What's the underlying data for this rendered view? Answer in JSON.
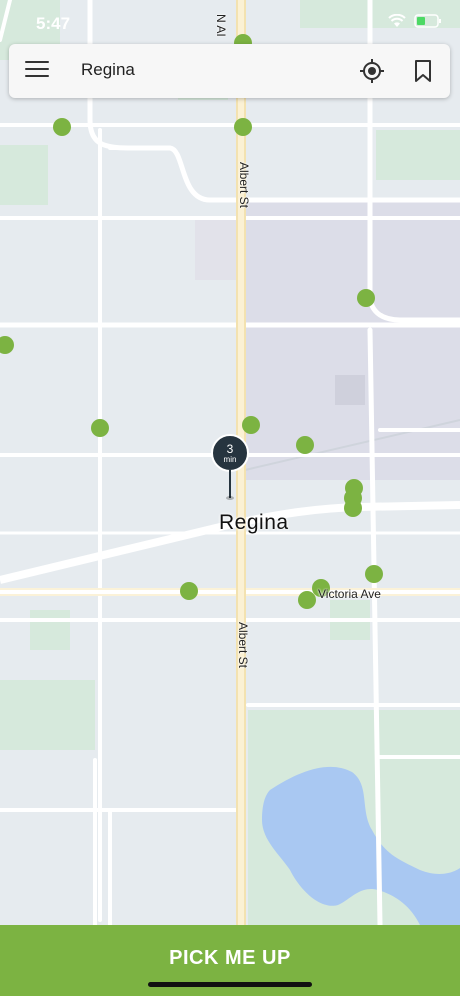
{
  "status_bar": {
    "time": "5:47"
  },
  "search": {
    "value": "Regina"
  },
  "map": {
    "city_label": "Regina",
    "streets": {
      "top_cut": "N AI",
      "albert_north": "Albert St",
      "albert_south": "Albert St",
      "victoria": "Victoria Ave"
    },
    "pin": {
      "minutes": "3",
      "unit": "min"
    }
  },
  "actions": {
    "pickup_label": "PICK ME UP"
  },
  "colors": {
    "accent": "#7cb342",
    "pin": "#26343f",
    "map_bg": "#e6ebef"
  }
}
